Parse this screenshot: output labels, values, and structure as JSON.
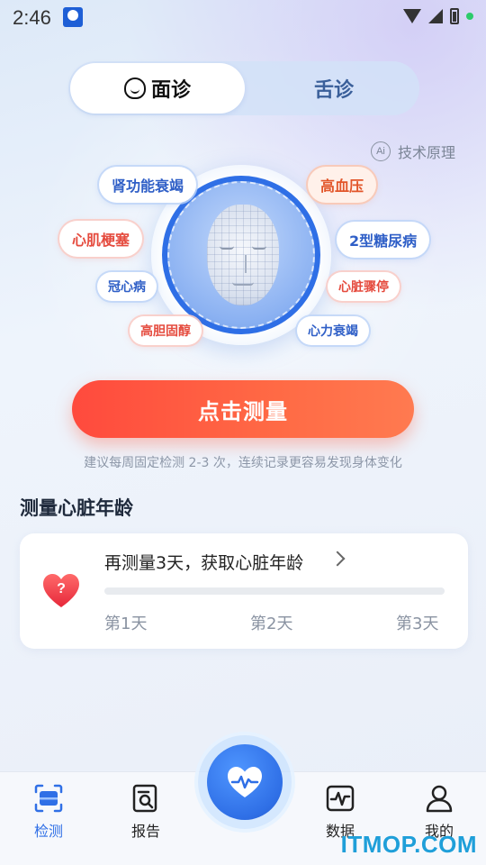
{
  "status_bar": {
    "time": "2:46"
  },
  "tabs": [
    {
      "label": "面诊",
      "active": true
    },
    {
      "label": "舌诊",
      "active": false
    }
  ],
  "tech_link": {
    "badge": "Ai",
    "label": "技术原理"
  },
  "disease_tags": [
    {
      "label": "肾功能衰竭",
      "color": "blue"
    },
    {
      "label": "高血压",
      "color": "orange"
    },
    {
      "label": "心肌梗塞",
      "color": "red"
    },
    {
      "label": "2型糖尿病",
      "color": "blue"
    },
    {
      "label": "冠心病",
      "color": "blue"
    },
    {
      "label": "心脏骤停",
      "color": "red"
    },
    {
      "label": "高胆固醇",
      "color": "red"
    },
    {
      "label": "心力衰竭",
      "color": "blue"
    }
  ],
  "measure_button": {
    "label": "点击测量"
  },
  "tip": "建议每周固定检测 2-3 次，连续记录更容易发现身体变化",
  "heart_age": {
    "section_title": "测量心脏年龄",
    "card_title": "再测量3天，获取心脏年龄",
    "heart_mark": "?",
    "progress": 0,
    "days": [
      "第1天",
      "第2天",
      "第3天"
    ]
  },
  "bottom_nav": [
    {
      "label": "检测",
      "icon": "scan-icon",
      "active": true
    },
    {
      "label": "报告",
      "icon": "report-search-icon",
      "active": false
    },
    {
      "label": "",
      "icon": "heart-pulse-icon",
      "active": false
    },
    {
      "label": "数据",
      "icon": "data-chart-icon",
      "active": false
    },
    {
      "label": "我的",
      "icon": "user-icon",
      "active": false
    }
  ],
  "watermark": "ITMOP.COM",
  "colors": {
    "accent": "#2f6fe6",
    "cta": "#ff5a45"
  }
}
